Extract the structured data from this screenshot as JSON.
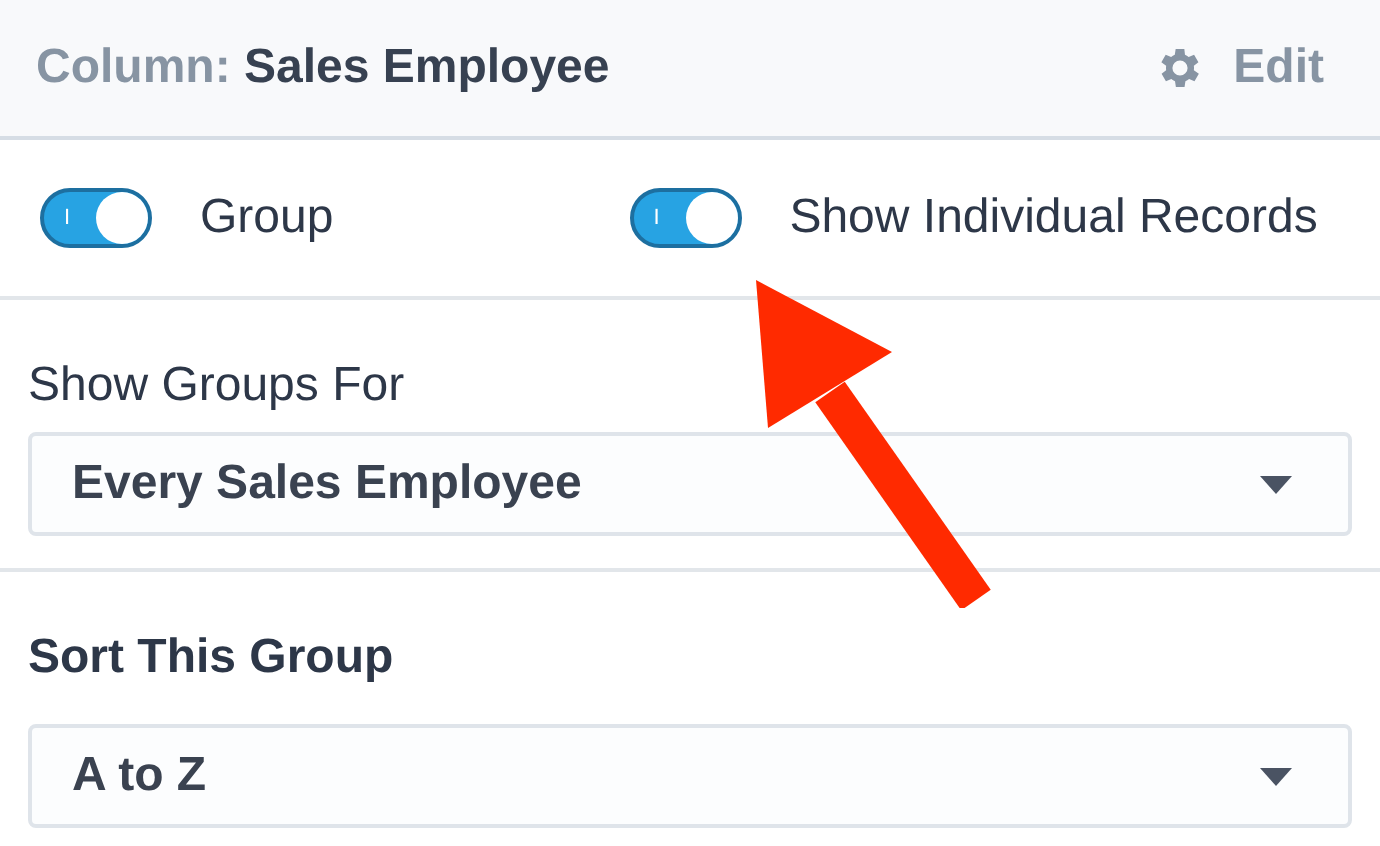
{
  "header": {
    "prefix": "Column:",
    "title": "Sales Employee",
    "edit_label": "Edit"
  },
  "toggles": [
    {
      "label": "Group",
      "on": true,
      "knob": "I"
    },
    {
      "label": "Show Individual Records",
      "on": true,
      "knob": "I"
    }
  ],
  "sections": [
    {
      "label": "Show Groups For",
      "label_bold": false,
      "value": "Every Sales Employee"
    },
    {
      "label": "Sort This Group",
      "label_bold": true,
      "value": "A to Z"
    }
  ]
}
